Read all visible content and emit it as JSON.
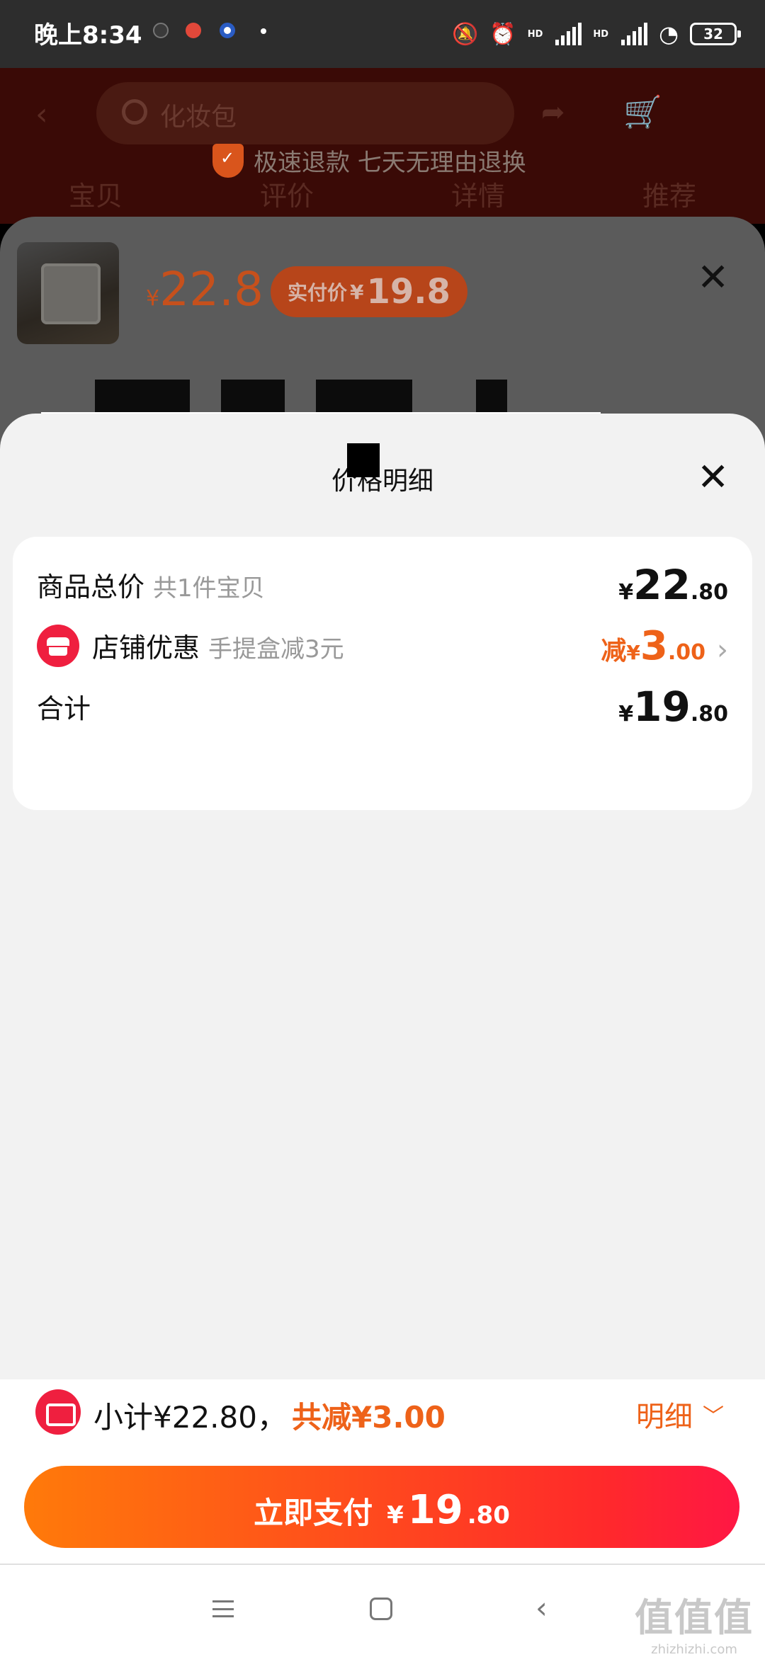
{
  "status_bar": {
    "time": "晚上8:34",
    "hd1": "HD",
    "hd2": "HD",
    "battery": "32"
  },
  "app_header": {
    "search_text": "化妆包",
    "banner": "极速退款 七天无理由退换",
    "tabs": [
      "宝贝",
      "评价",
      "详情",
      "推荐"
    ]
  },
  "sku_panel": {
    "price_currency": "¥",
    "price": "22.8",
    "actual_label": "实付价",
    "actual_currency": "¥",
    "actual_price": "19.8"
  },
  "price_detail": {
    "title": "价格明细",
    "rows": [
      {
        "label": "商品总价",
        "sub": "共1件宝贝",
        "currency": "¥",
        "int": "22",
        "dec": ".80"
      },
      {
        "label": "店铺优惠",
        "sub": "手提盒减3元",
        "prefix": "减",
        "currency": "¥",
        "int": "3",
        "dec": ".00"
      },
      {
        "label": "合计",
        "currency": "¥",
        "int": "19",
        "dec": ".80"
      }
    ]
  },
  "checkout": {
    "subtotal": "小计¥22.80，",
    "saved": "共减¥3.00",
    "detail_label": "明细",
    "pay_label": "立即支付",
    "pay_currency": "¥",
    "pay_int": "19",
    "pay_dec": ".80"
  },
  "watermark": {
    "logo": "值值值",
    "site": "zhizhizhi.com"
  },
  "colors": {
    "accent": "#ee6219",
    "red": "#ef1f3f",
    "sheet_bg": "#f2f2f2"
  },
  "icons": [
    "search-icon",
    "shield-icon",
    "close-icon",
    "shop-icon",
    "coupon-icon",
    "chevron-right-icon",
    "chevron-down-icon",
    "menu-icon",
    "home-icon",
    "back-icon"
  ]
}
